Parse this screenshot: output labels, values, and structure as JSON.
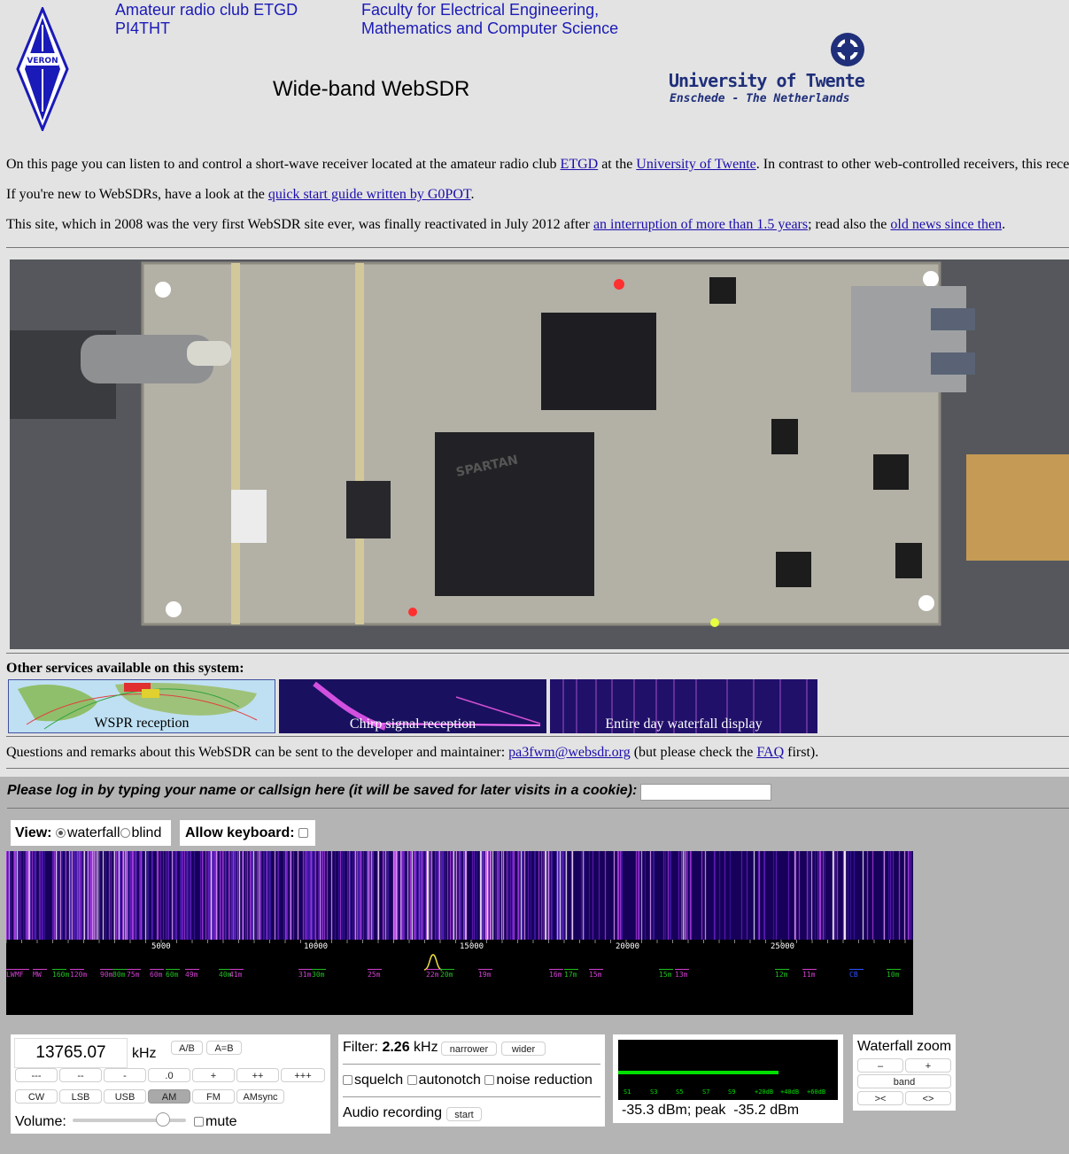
{
  "header": {
    "club_line1": "Amateur radio club ETGD",
    "club_line2": "PI4THT",
    "faculty_line1": "Faculty for Electrical Engineering,",
    "faculty_line2": "Mathematics and Computer Science",
    "title": "Wide-band WebSDR",
    "veron_logo_text": "VERON",
    "ut_name": "University of Twente",
    "ut_place": "Enschede - The Netherlands"
  },
  "intro": {
    "p1_a": "On this page you can listen to and control a short-wave receiver located at the amateur radio club ",
    "p1_link1": "ETGD",
    "p1_b": " at the ",
    "p1_link2": "University of Twente",
    "p1_c": ". In contrast to other web-controlled receivers, this rece",
    "p2_a": "If you're new to WebSDRs, have a look at the ",
    "p2_link": "quick start guide written by G0POT",
    "p2_b": ".",
    "p3_a": "This site, which in 2008 was the very first WebSDR site ever, was finally reactivated in July 2012 after ",
    "p3_link1": "an interruption of more than 1.5 years",
    "p3_b": "; read also the ",
    "p3_link2": "old news since then",
    "p3_c": "."
  },
  "services": {
    "heading": "Other services available on this system:",
    "items": [
      "WSPR reception",
      "Chirp signal reception",
      "Entire day waterfall display"
    ]
  },
  "contact": {
    "text_a": "Questions and remarks about this WebSDR can be sent to the developer and maintainer: ",
    "email": "pa3fwm@websdr.org",
    "text_b": " (but please check the ",
    "faq": "FAQ",
    "text_c": " first)."
  },
  "login": {
    "prompt": "Please log in by typing your name or callsign here (it will be saved for later visits in a cookie):",
    "value": ""
  },
  "view": {
    "label": "View:",
    "options": [
      "waterfall",
      "blind"
    ],
    "selected": "waterfall",
    "keyboard_label": "Allow keyboard:"
  },
  "freq_scale": {
    "ticks": [
      "5000",
      "10000",
      "15000",
      "20000",
      "25000"
    ]
  },
  "bands": [
    {
      "label": "LW",
      "color": "#d040d0"
    },
    {
      "label": "MF",
      "color": "#d040d0"
    },
    {
      "label": "MW",
      "color": "#d040d0"
    },
    {
      "label": "160m",
      "color": "#20c020"
    },
    {
      "label": "120m",
      "color": "#d040d0"
    },
    {
      "label": "90m",
      "color": "#d040d0"
    },
    {
      "label": "80m",
      "color": "#20c020"
    },
    {
      "label": "75m",
      "color": "#d040d0"
    },
    {
      "label": "60m",
      "color": "#d040d0"
    },
    {
      "label": "60m",
      "color": "#20c020"
    },
    {
      "label": "49m",
      "color": "#d040d0"
    },
    {
      "label": "40m",
      "color": "#20c020"
    },
    {
      "label": "41m",
      "color": "#d040d0"
    },
    {
      "label": "31m",
      "color": "#d040d0"
    },
    {
      "label": "30m",
      "color": "#20c020"
    },
    {
      "label": "25m",
      "color": "#d040d0"
    },
    {
      "label": "22m",
      "color": "#d040d0"
    },
    {
      "label": "20m",
      "color": "#20c020"
    },
    {
      "label": "19m",
      "color": "#d040d0"
    },
    {
      "label": "16m",
      "color": "#d040d0"
    },
    {
      "label": "17m",
      "color": "#20c020"
    },
    {
      "label": "15m",
      "color": "#d040d0"
    },
    {
      "label": "15m",
      "color": "#20c020"
    },
    {
      "label": "13m",
      "color": "#d040d0"
    },
    {
      "label": "12m",
      "color": "#20c020"
    },
    {
      "label": "11m",
      "color": "#d040d0"
    },
    {
      "label": "CB",
      "color": "#3050ff"
    },
    {
      "label": "10m",
      "color": "#20c020"
    }
  ],
  "tuner": {
    "frequency": "13765.07",
    "unit": "kHz",
    "ab_label": "A/B",
    "aeqb_label": "A=B",
    "step_buttons": [
      "---",
      "--",
      "-",
      ".0",
      "+",
      "++",
      "+++"
    ],
    "modes": [
      "CW",
      "LSB",
      "USB",
      "AM",
      "FM",
      "AMsync"
    ],
    "active_mode": "AM",
    "volume_label": "Volume:",
    "volume_level": 0.8,
    "mute_label": "mute"
  },
  "filter": {
    "label": "Filter:",
    "bandwidth": "2.26",
    "unit": "kHz",
    "narrower": "narrower",
    "wider": "wider",
    "squelch": "squelch",
    "autonotch": "autonotch",
    "noise_reduction": "noise reduction",
    "recording_label": "Audio recording",
    "start": "start"
  },
  "smeter": {
    "scale": [
      "S1",
      "S3",
      "S5",
      "S7",
      "S9",
      "+20dB",
      "+40dB",
      "+60dB"
    ],
    "level_fraction": 0.73,
    "reading": "-35.3 dBm; peak  -35.2 dBm",
    "color": "#00e000"
  },
  "zoom": {
    "title": "Waterfall zoom",
    "minus": "–",
    "plus": "+",
    "band": "band",
    "left": "><",
    "right": "<>"
  }
}
